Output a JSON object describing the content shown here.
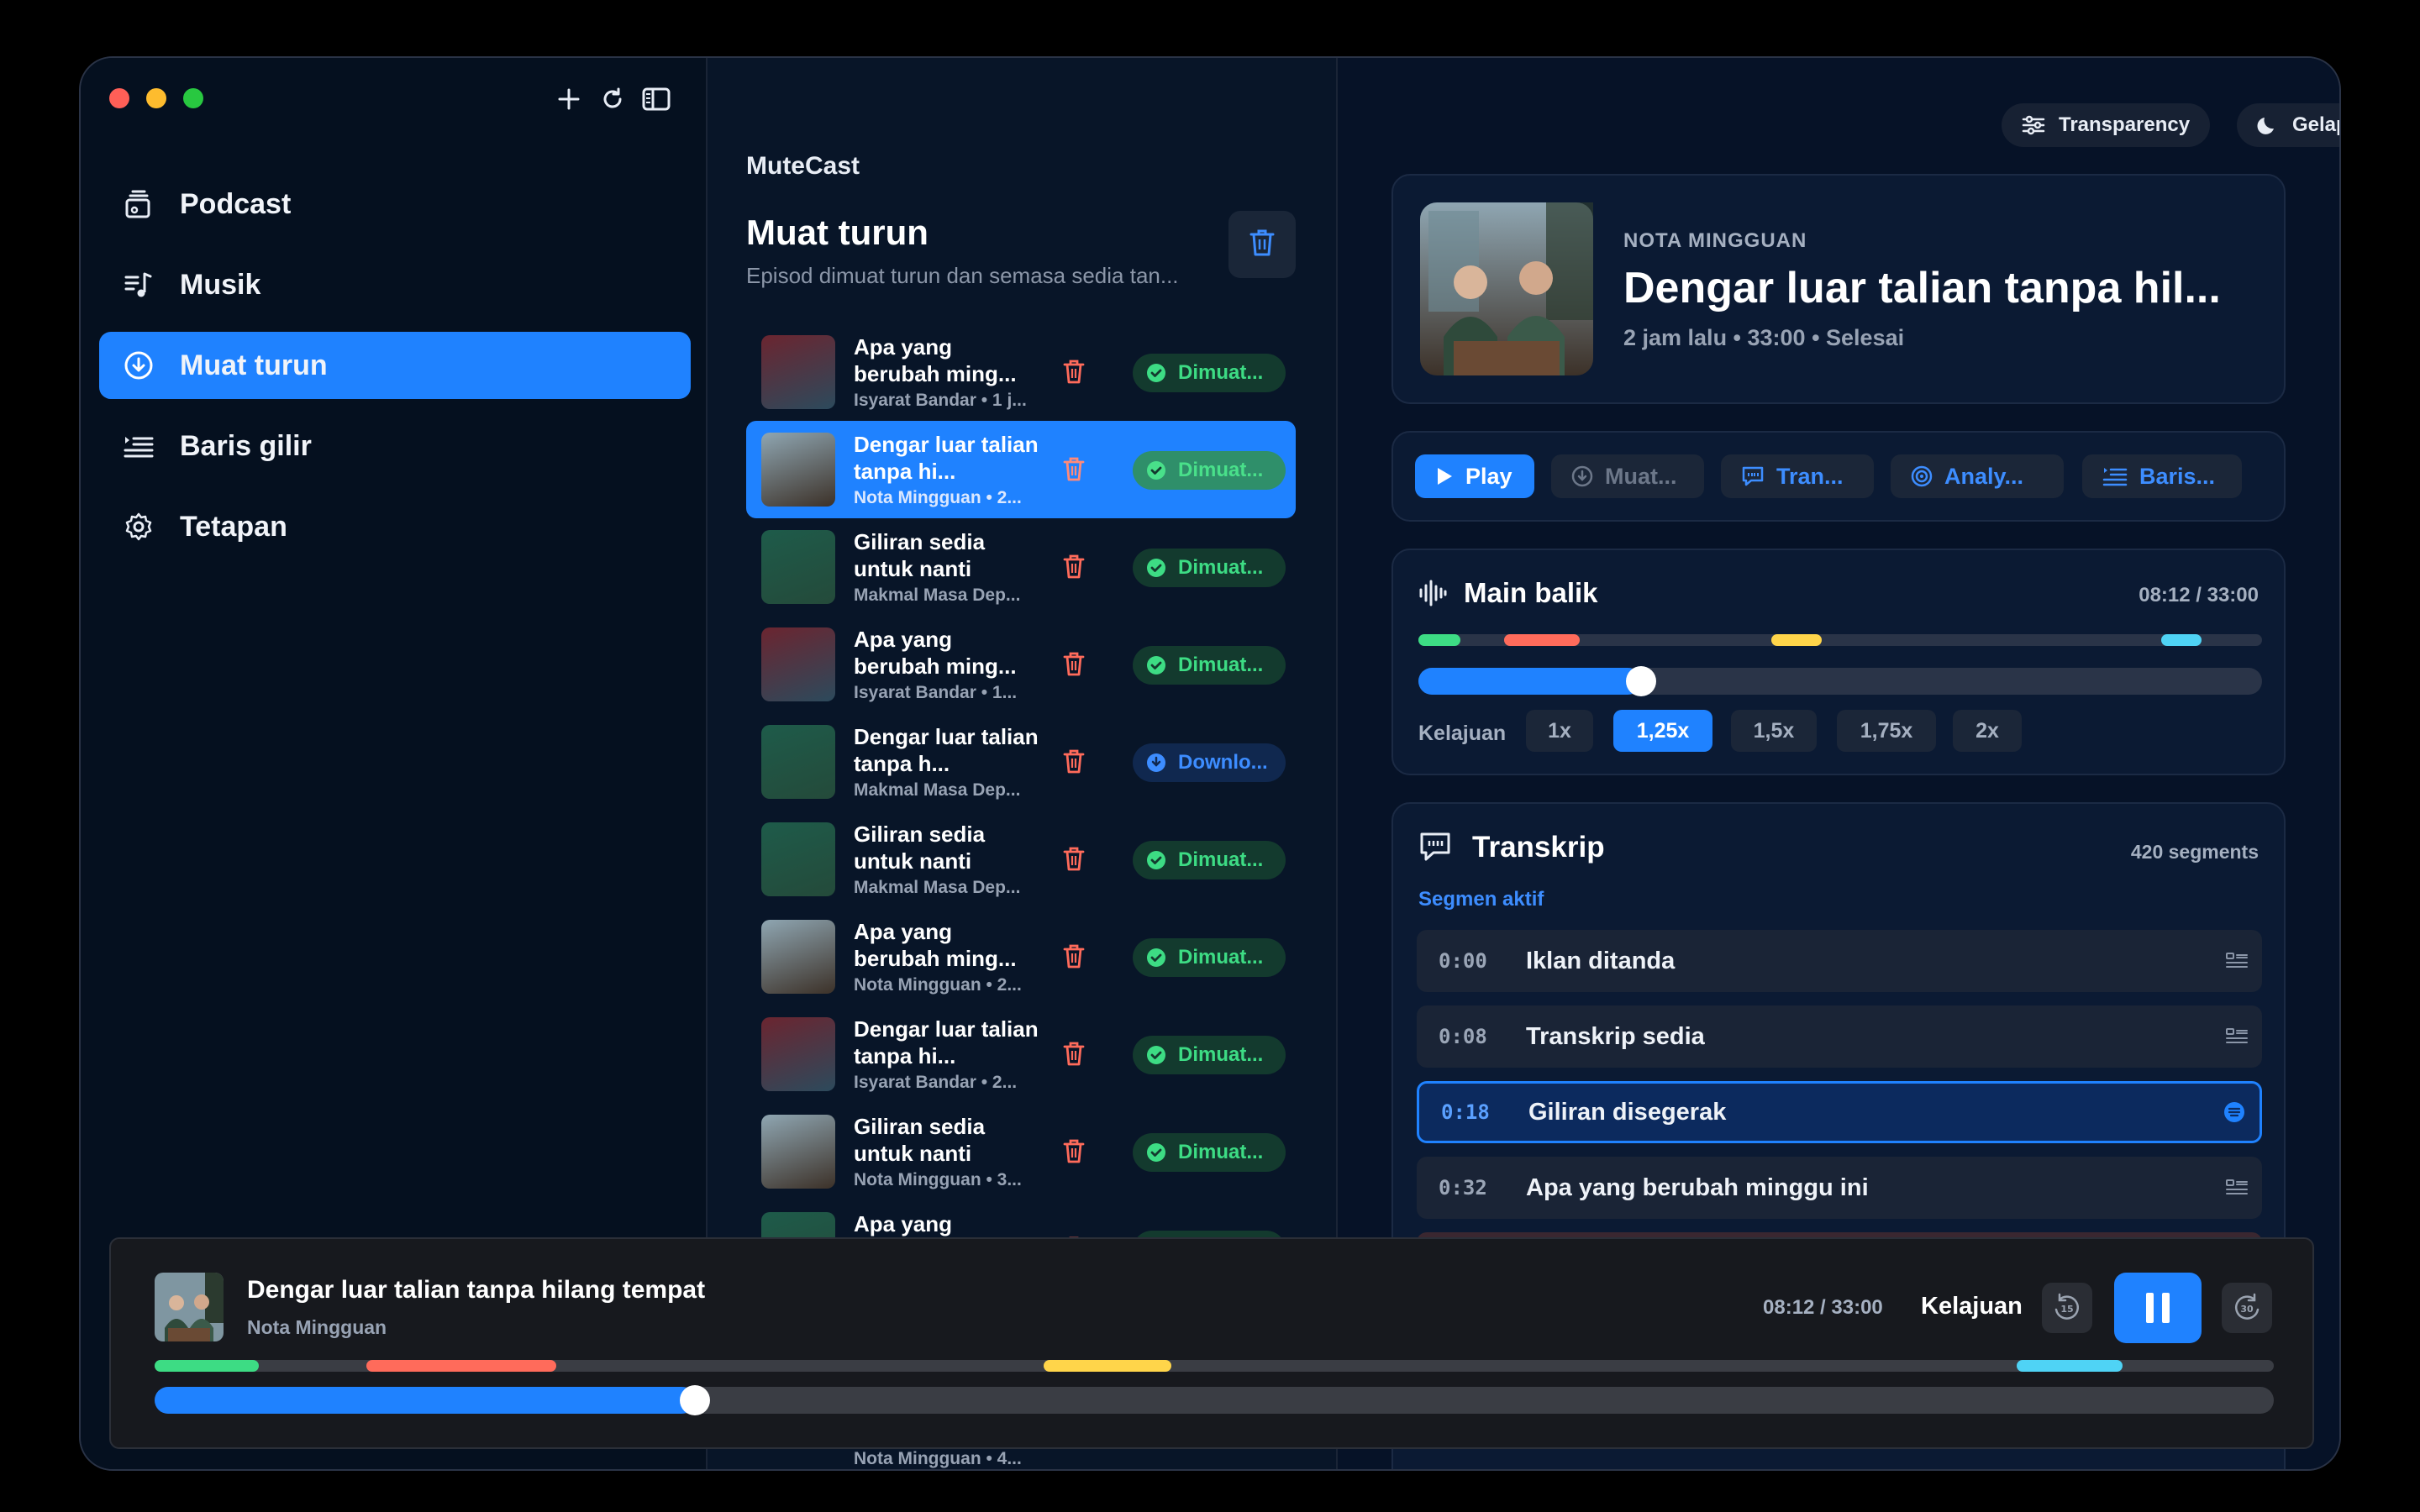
{
  "sidebar": {
    "items": [
      {
        "label": "Podcast",
        "icon": "podcast-icon"
      },
      {
        "label": "Musik",
        "icon": "music-icon"
      },
      {
        "label": "Muat turun",
        "icon": "download-icon",
        "active": true
      },
      {
        "label": "Baris gilir",
        "icon": "queue-icon"
      },
      {
        "label": "Tetapan",
        "icon": "gear-icon"
      }
    ]
  },
  "list": {
    "brand": "MuteCast",
    "title": "Muat turun",
    "subtitle": "Episod dimuat turun dan semasa sedia tan...",
    "episodes": [
      {
        "title": "Apa yang berubah ming...",
        "meta": "Isyarat Bandar • 1 j...",
        "status": "Dimuat...",
        "kind": "done"
      },
      {
        "title": "Dengar luar talian tanpa hi...",
        "meta": "Nota Mingguan • 2...",
        "status": "Dimuat...",
        "kind": "done",
        "selected": true
      },
      {
        "title": "Giliran sedia untuk nanti",
        "meta": "Makmal Masa Dep...",
        "status": "Dimuat...",
        "kind": "done"
      },
      {
        "title": "Apa yang berubah ming...",
        "meta": "Isyarat Bandar • 1...",
        "status": "Dimuat...",
        "kind": "done"
      },
      {
        "title": "Dengar luar talian tanpa h...",
        "meta": "Makmal Masa Dep...",
        "status": "Downlo...",
        "kind": "dl"
      },
      {
        "title": "Giliran sedia untuk nanti",
        "meta": "Makmal Masa Dep...",
        "status": "Dimuat...",
        "kind": "done"
      },
      {
        "title": "Apa yang berubah ming...",
        "meta": "Nota Mingguan • 2...",
        "status": "Dimuat...",
        "kind": "done"
      },
      {
        "title": "Dengar luar talian tanpa hi...",
        "meta": "Isyarat Bandar • 2...",
        "status": "Dimuat...",
        "kind": "done"
      },
      {
        "title": "Giliran sedia untuk nanti",
        "meta": "Nota Mingguan • 3...",
        "status": "Dimuat...",
        "kind": "done"
      },
      {
        "title": "Apa yang",
        "meta": "",
        "status": "",
        "kind": "done"
      }
    ],
    "peek_meta": "Nota Mingguan • 4..."
  },
  "top": {
    "transparency": "Transparency",
    "theme": "Gelap"
  },
  "hero": {
    "kicker": "NOTA MINGGUAN",
    "title": "Dengar luar talian tanpa hil...",
    "meta": "2 jam lalu • 33:00 • Selesai"
  },
  "actions": {
    "play": "Play",
    "download": "Muat...",
    "transcript": "Tran...",
    "analyze": "Analy...",
    "queue": "Baris..."
  },
  "playback": {
    "title": "Main balik",
    "time": "08:12 / 33:00",
    "progress": 0.2485,
    "speed_label": "Kelajuan",
    "speeds": [
      "1x",
      "1,25x",
      "1,5x",
      "1,75x",
      "2x"
    ],
    "speed_selected": "1,25x"
  },
  "transcript": {
    "title": "Transkrip",
    "count": "420 segments",
    "active_label": "Segmen aktif",
    "rows": [
      {
        "time": "0:00",
        "text": "Iklan ditanda"
      },
      {
        "time": "0:08",
        "text": "Transkrip sedia"
      },
      {
        "time": "0:18",
        "text": "Giliran disegerak",
        "active": true
      },
      {
        "time": "0:32",
        "text": "Apa yang berubah minggu ini"
      }
    ]
  },
  "player": {
    "title": "Dengar luar talian tanpa hilang tempat",
    "show": "Nota Mingguan",
    "time": "08:12 / 33:00",
    "speed_label": "Kelajuan",
    "progress": 0.2485
  },
  "colors": {
    "accent": "#1f82ff",
    "green": "#3ddc84",
    "red": "#ff6b5b",
    "yellow": "#ffd54a",
    "cyan": "#4fd3f5"
  }
}
